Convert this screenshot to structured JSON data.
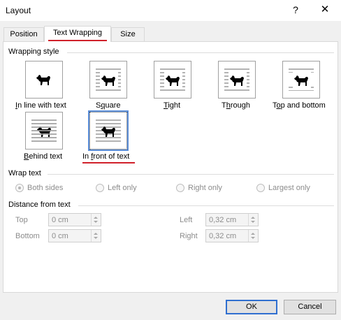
{
  "window": {
    "title": "Layout",
    "help_glyph": "?",
    "close_glyph": "✕"
  },
  "tabs": [
    {
      "label": "Position"
    },
    {
      "label": "Text Wrapping",
      "selected": true
    },
    {
      "label": "Size"
    }
  ],
  "wrapping_style": {
    "heading": "Wrapping style",
    "options": [
      {
        "pre": "",
        "key": "I",
        "post": "n line with text"
      },
      {
        "pre": "S",
        "key": "q",
        "post": "uare"
      },
      {
        "pre": "",
        "key": "T",
        "post": "ight"
      },
      {
        "pre": "T",
        "key": "h",
        "post": "rough"
      },
      {
        "pre": "T",
        "key": "o",
        "post": "p and bottom"
      },
      {
        "pre": "",
        "key": "B",
        "post": "ehind text"
      },
      {
        "pre": "In ",
        "key": "f",
        "post": "ront of text",
        "selected": true
      }
    ],
    "accent_color": "#d0202a"
  },
  "wrap_text": {
    "heading": "Wrap text",
    "options": [
      {
        "label": "Both sides",
        "checked": true
      },
      {
        "label": "Left only",
        "checked": false
      },
      {
        "label": "Right only",
        "checked": false
      },
      {
        "label": "Largest only",
        "checked": false
      }
    ]
  },
  "distance": {
    "heading": "Distance from text",
    "top": {
      "label": "Top",
      "value": "0 cm"
    },
    "bottom": {
      "label": "Bottom",
      "value": "0 cm"
    },
    "left": {
      "label": "Left",
      "value": "0,32 cm"
    },
    "right": {
      "label": "Right",
      "value": "0,32 cm"
    }
  },
  "buttons": {
    "ok": "OK",
    "cancel": "Cancel"
  }
}
